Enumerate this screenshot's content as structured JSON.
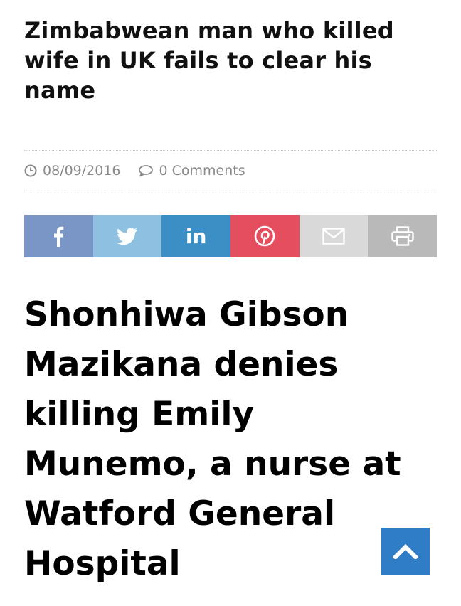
{
  "article": {
    "headline": "Zimbabwean man who killed wife in UK fails to clear his name",
    "date": "08/09/2016",
    "comments": "0 Comments",
    "subheadline": "Shonhiwa Gibson Mazikana denies killing Emily Munemo, a nurse at Watford General Hospital"
  },
  "share": {
    "buttons": [
      {
        "id": "facebook",
        "icon": "facebook-icon",
        "color": "#7a96c7"
      },
      {
        "id": "twitter",
        "icon": "twitter-icon",
        "color": "#8ec1e1"
      },
      {
        "id": "linkedin",
        "icon": "linkedin-icon",
        "label": "in",
        "color": "#3b8fc4"
      },
      {
        "id": "pinterest",
        "icon": "pinterest-icon",
        "color": "#e54e5e"
      },
      {
        "id": "email",
        "icon": "envelope-icon",
        "color": "#d9d9d9"
      },
      {
        "id": "print",
        "icon": "printer-icon",
        "color": "#b9b9b9"
      }
    ]
  },
  "back_to_top": {
    "icon": "chevron-up-icon",
    "color": "#2f7cc7"
  }
}
